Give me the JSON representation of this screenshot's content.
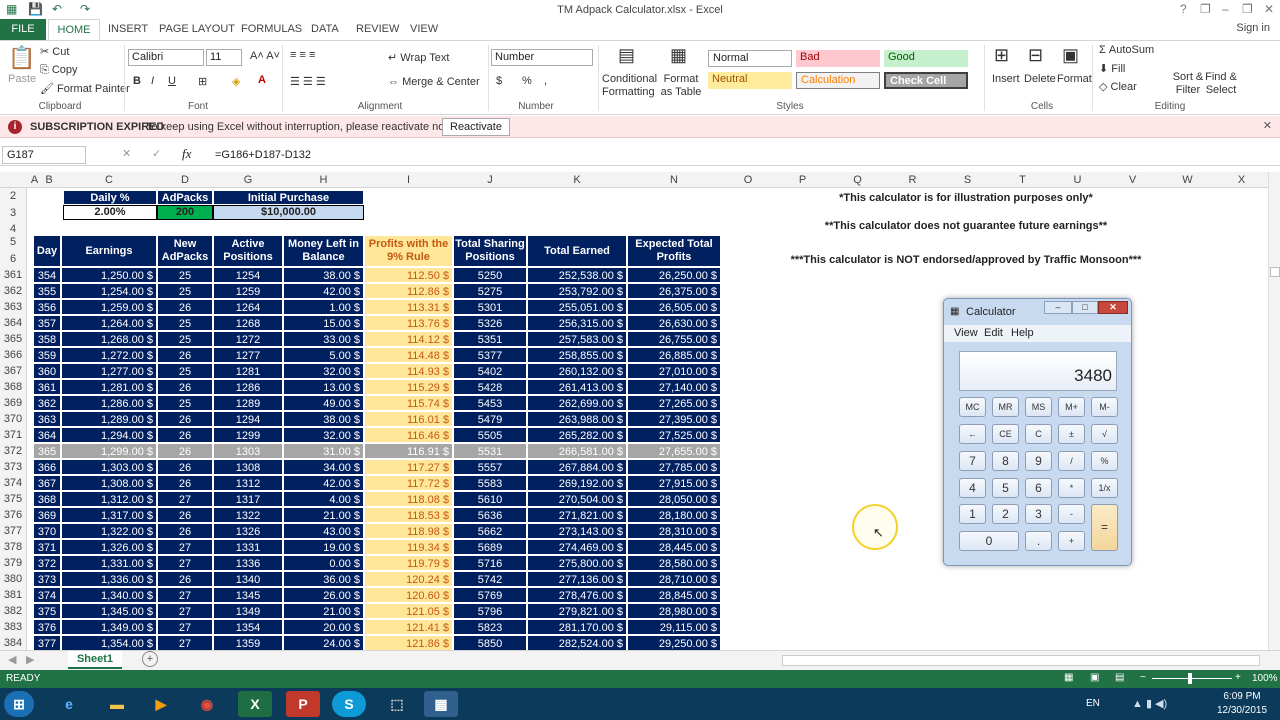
{
  "window": {
    "title": "TM Adpack Calculator.xlsx - Excel",
    "min": "–",
    "restore": "❐",
    "close": "✕",
    "help": "?"
  },
  "ribbon": {
    "tabs": [
      "FILE",
      "HOME",
      "INSERT",
      "PAGE LAYOUT",
      "FORMULAS",
      "DATA",
      "REVIEW",
      "VIEW"
    ],
    "signin": "Sign in",
    "clipboard": {
      "paste": "Paste",
      "cut": "Cut",
      "copy": "Copy",
      "format_painter": "Format Painter",
      "label": "Clipboard"
    },
    "font": {
      "name": "Calibri",
      "size": "11",
      "label": "Font",
      "bold": "B",
      "italic": "I",
      "underline": "U"
    },
    "alignment": {
      "wrap": "Wrap Text",
      "merge": "Merge & Center",
      "label": "Alignment"
    },
    "number": {
      "format": "Number",
      "currency": "$",
      "percent": "%",
      "comma": ",",
      "label": "Number"
    },
    "styles": {
      "cond": "Conditional Formatting",
      "table": "Format as Table",
      "normal": "Normal",
      "bad": "Bad",
      "good": "Good",
      "neutral": "Neutral",
      "calculation": "Calculation",
      "check": "Check Cell",
      "label": "Styles"
    },
    "cells": {
      "insert": "Insert",
      "delete": "Delete",
      "format": "Format",
      "label": "Cells"
    },
    "editing": {
      "autosum": "AutoSum",
      "fill": "Fill",
      "clear": "Clear",
      "sort": "Sort & Filter",
      "find": "Find & Select",
      "label": "Editing"
    }
  },
  "message": {
    "title": "SUBSCRIPTION EXPIRED",
    "text": "To keep using Excel without interruption, please reactivate now.",
    "button": "Reactivate",
    "icon": "i"
  },
  "formula_bar": {
    "namebox": "G187",
    "fx": "fx",
    "formula": "=G186+D187-D132"
  },
  "columns": [
    "A",
    "B",
    "C",
    "D",
    "G",
    "H",
    "I",
    "J",
    "K",
    "N",
    "O",
    "P",
    "Q",
    "R",
    "S",
    "T",
    "U",
    "V",
    "W",
    "X"
  ],
  "top": {
    "daily_label": "Daily %",
    "daily_value": "2.00%",
    "adpacks_label": "AdPacks",
    "adpacks_value": "200",
    "initial_label": "Initial Purchase",
    "initial_value": "$10,000.00"
  },
  "headers": {
    "day": "Day",
    "earnings": "Earnings",
    "new_adpacks": "New AdPacks",
    "active": "Active Positions",
    "money_left": "Money Left in Balance",
    "profits": "Profits with the 9% Rule",
    "total_sharing": "Total Sharing Positions",
    "total_earned": "Total Earned",
    "expected": "Expected Total Profits"
  },
  "notes": [
    "*This calculator is for illustration purposes only*",
    "**This calculator does not guarantee future earnings**",
    "***This calculator is NOT endorsed/approved by Traffic Monsoon***"
  ],
  "row_numbers": [
    "2",
    "3",
    "4",
    "5",
    "6",
    "361",
    "362",
    "363",
    "364",
    "365",
    "366",
    "367",
    "368",
    "369",
    "370",
    "371",
    "372",
    "373",
    "374",
    "375",
    "376",
    "377",
    "378",
    "379",
    "380",
    "381",
    "382",
    "383",
    "384"
  ],
  "rows": [
    [
      "354",
      "1,250.00 $",
      "25",
      "1254",
      "38.00 $",
      "112.50 $",
      "5250",
      "252,538.00 $",
      "26,250.00 $"
    ],
    [
      "355",
      "1,254.00 $",
      "25",
      "1259",
      "42.00 $",
      "112.86 $",
      "5275",
      "253,792.00 $",
      "26,375.00 $"
    ],
    [
      "356",
      "1,259.00 $",
      "26",
      "1264",
      "1.00 $",
      "113.31 $",
      "5301",
      "255,051.00 $",
      "26,505.00 $"
    ],
    [
      "357",
      "1,264.00 $",
      "25",
      "1268",
      "15.00 $",
      "113.76 $",
      "5326",
      "256,315.00 $",
      "26,630.00 $"
    ],
    [
      "358",
      "1,268.00 $",
      "25",
      "1272",
      "33.00 $",
      "114.12 $",
      "5351",
      "257,583.00 $",
      "26,755.00 $"
    ],
    [
      "359",
      "1,272.00 $",
      "26",
      "1277",
      "5.00 $",
      "114.48 $",
      "5377",
      "258,855.00 $",
      "26,885.00 $"
    ],
    [
      "360",
      "1,277.00 $",
      "25",
      "1281",
      "32.00 $",
      "114.93 $",
      "5402",
      "260,132.00 $",
      "27,010.00 $"
    ],
    [
      "361",
      "1,281.00 $",
      "26",
      "1286",
      "13.00 $",
      "115.29 $",
      "5428",
      "261,413.00 $",
      "27,140.00 $"
    ],
    [
      "362",
      "1,286.00 $",
      "25",
      "1289",
      "49.00 $",
      "115.74 $",
      "5453",
      "262,699.00 $",
      "27,265.00 $"
    ],
    [
      "363",
      "1,289.00 $",
      "26",
      "1294",
      "38.00 $",
      "116.01 $",
      "5479",
      "263,988.00 $",
      "27,395.00 $"
    ],
    [
      "364",
      "1,294.00 $",
      "26",
      "1299",
      "32.00 $",
      "116.46 $",
      "5505",
      "265,282.00 $",
      "27,525.00 $"
    ],
    [
      "365",
      "1,299.00 $",
      "26",
      "1303",
      "31.00 $",
      "116.91 $",
      "5531",
      "266,581.00 $",
      "27,655.00 $"
    ],
    [
      "366",
      "1,303.00 $",
      "26",
      "1308",
      "34.00 $",
      "117.27 $",
      "5557",
      "267,884.00 $",
      "27,785.00 $"
    ],
    [
      "367",
      "1,308.00 $",
      "26",
      "1312",
      "42.00 $",
      "117.72 $",
      "5583",
      "269,192.00 $",
      "27,915.00 $"
    ],
    [
      "368",
      "1,312.00 $",
      "27",
      "1317",
      "4.00 $",
      "118.08 $",
      "5610",
      "270,504.00 $",
      "28,050.00 $"
    ],
    [
      "369",
      "1,317.00 $",
      "26",
      "1322",
      "21.00 $",
      "118.53 $",
      "5636",
      "271,821.00 $",
      "28,180.00 $"
    ],
    [
      "370",
      "1,322.00 $",
      "26",
      "1326",
      "43.00 $",
      "118.98 $",
      "5662",
      "273,143.00 $",
      "28,310.00 $"
    ],
    [
      "371",
      "1,326.00 $",
      "27",
      "1331",
      "19.00 $",
      "119.34 $",
      "5689",
      "274,469.00 $",
      "28,445.00 $"
    ],
    [
      "372",
      "1,331.00 $",
      "27",
      "1336",
      "0.00 $",
      "119.79 $",
      "5716",
      "275,800.00 $",
      "28,580.00 $"
    ],
    [
      "373",
      "1,336.00 $",
      "26",
      "1340",
      "36.00 $",
      "120.24 $",
      "5742",
      "277,136.00 $",
      "28,710.00 $"
    ],
    [
      "374",
      "1,340.00 $",
      "27",
      "1345",
      "26.00 $",
      "120.60 $",
      "5769",
      "278,476.00 $",
      "28,845.00 $"
    ],
    [
      "375",
      "1,345.00 $",
      "27",
      "1349",
      "21.00 $",
      "121.05 $",
      "5796",
      "279,821.00 $",
      "28,980.00 $"
    ],
    [
      "376",
      "1,349.00 $",
      "27",
      "1354",
      "20.00 $",
      "121.41 $",
      "5823",
      "281,170.00 $",
      "29,115.00 $"
    ],
    [
      "377",
      "1,354.00 $",
      "27",
      "1359",
      "24.00 $",
      "121.86 $",
      "5850",
      "282,524.00 $",
      "29,250.00 $"
    ]
  ],
  "highlight_row": 11,
  "sheet": {
    "tab": "Sheet1",
    "add": "+"
  },
  "status": {
    "ready": "READY",
    "zoom": "100%"
  },
  "taskbar": {
    "lang": "EN",
    "time": "6:09 PM",
    "date": "12/30/2015"
  },
  "calculator": {
    "title": "Calculator",
    "menu": [
      "View",
      "Edit",
      "Help"
    ],
    "display": "3480",
    "keys": [
      [
        "MC",
        "MR",
        "MS",
        "M+",
        "M-"
      ],
      [
        "←",
        "CE",
        "C",
        "±",
        "√"
      ],
      [
        "7",
        "8",
        "9",
        "/",
        "%"
      ],
      [
        "4",
        "5",
        "6",
        "*",
        "1/x"
      ],
      [
        "1",
        "2",
        "3",
        "-",
        ""
      ],
      [
        "0",
        "",
        ".",
        "+",
        ""
      ]
    ],
    "equals": "="
  },
  "colors": {
    "excel_green": "#217346",
    "navy": "#002060",
    "profit_yellow": "#ffe699",
    "bright_green": "#00b050"
  }
}
